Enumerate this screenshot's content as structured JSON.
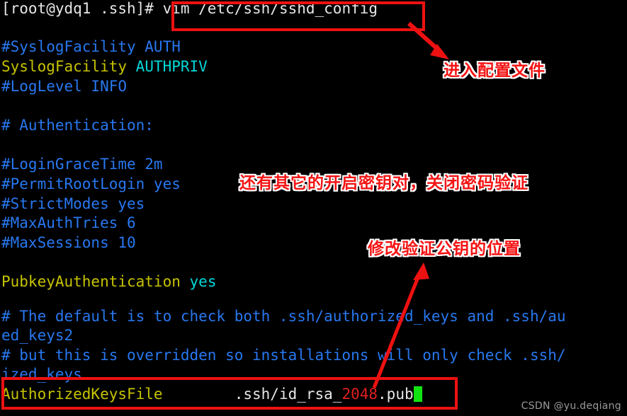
{
  "terminal": {
    "prompt": "[root@ydq1 .ssh]#",
    "command": "vim /etc/ssh/sshd_config",
    "lines": {
      "l1_comment": "#SyslogFacility AUTH",
      "l2_key": "SyslogFacility",
      "l2_value": "AUTHPRIV",
      "l3_comment": "#LogLevel INFO",
      "l4_comment": "# Authentication:",
      "l5_comment": "#LoginGraceTime 2m",
      "l6_comment": "#PermitRootLogin yes",
      "l7_comment": "#StrictModes yes",
      "l8_comment": "#MaxAuthTries 6",
      "l9_comment": "#MaxSessions 10",
      "l10_key": "PubkeyAuthentication",
      "l10_value": "yes",
      "l11_comment_a": "# The default is to check both .ssh/authorized_keys and .ssh/au",
      "l11_comment_b": "ed_keys2",
      "l12_comment_a": "# but this is overridden so installations will only check .ssh/",
      "l12_comment_b": "ized_keys",
      "l13_key": "AuthorizedKeysFile",
      "l13_path_pre": ".ssh/id_rsa_",
      "l13_path_num": "2048",
      "l13_path_post": ".pub"
    }
  },
  "annotations": {
    "command_box_label": "vim-command-highlight",
    "enter_config_file": "进入配置文件",
    "other_keypair_note": "还有其它的开启密钥对，关闭密码验证",
    "modify_pubkey_location": "修改验证公钥的位置",
    "authorized_keys_box_label": "authorized-keys-line-highlight"
  },
  "watermark": {
    "text": "CSDN @yu.deqiang"
  },
  "colors": {
    "background": "#000000",
    "comment_blue": "#2878f0",
    "key_yellow": "#c7c300",
    "value_cyan": "#00d8d8",
    "number_red": "#e02020",
    "annotation_red": "#ee1111",
    "cursor_green": "#12e412",
    "text_white": "#e6e6e6"
  }
}
